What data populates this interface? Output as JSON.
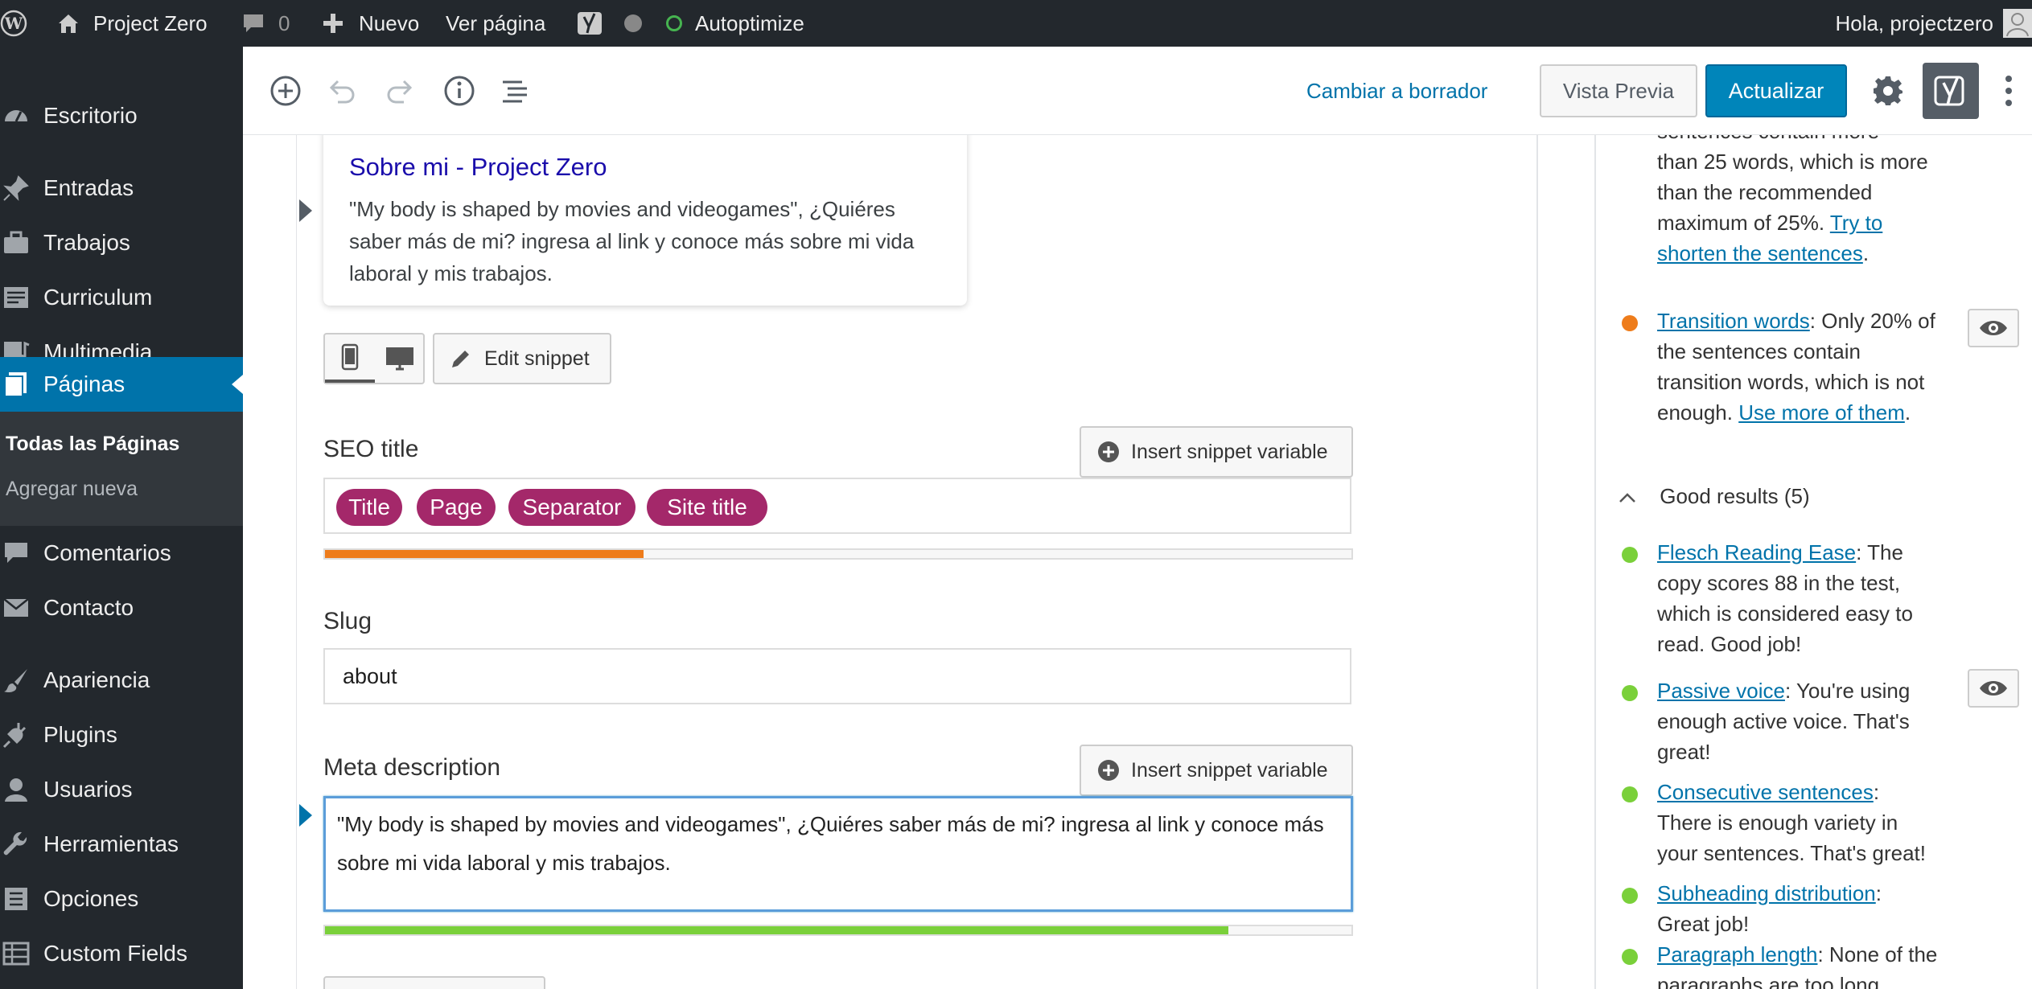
{
  "admin_bar": {
    "site_name": "Project Zero",
    "comments_count": "0",
    "new_label": "Nuevo",
    "view_page_label": "Ver página",
    "autoptimize_label": "Autoptimize",
    "greeting": "Hola, projectzero"
  },
  "sidebar": {
    "items": [
      {
        "label": "Escritorio",
        "icon": "dashboard-icon"
      },
      {
        "label": "Entradas",
        "icon": "pin-icon"
      },
      {
        "label": "Trabajos",
        "icon": "portfolio-icon"
      },
      {
        "label": "Curriculum",
        "icon": "document-icon"
      },
      {
        "label": "Multimedia",
        "icon": "media-icon"
      },
      {
        "label": "Páginas",
        "icon": "pages-icon"
      },
      {
        "label": "Comentarios",
        "icon": "comment-icon"
      },
      {
        "label": "Contacto",
        "icon": "mail-icon"
      },
      {
        "label": "Apariencia",
        "icon": "brush-icon"
      },
      {
        "label": "Plugins",
        "icon": "plugin-icon"
      },
      {
        "label": "Usuarios",
        "icon": "user-icon"
      },
      {
        "label": "Herramientas",
        "icon": "wrench-icon"
      },
      {
        "label": "Opciones",
        "icon": "settings-icon"
      },
      {
        "label": "Custom Fields",
        "icon": "table-icon"
      }
    ],
    "submenu": {
      "all_pages": "Todas las Páginas",
      "add_new": "Agregar nueva"
    }
  },
  "header": {
    "switch_to_draft": "Cambiar a borrador",
    "preview": "Vista Previa",
    "update": "Actualizar"
  },
  "snippet": {
    "title": "Sobre mi - Project Zero",
    "description": "\"My body is shaped by movies and videogames\", ¿Quiéres saber más de mi? ingresa al link y conoce más sobre mi vida laboral y mis trabajos.",
    "edit_snippet": "Edit snippet"
  },
  "seo": {
    "seo_title_label": "SEO title",
    "insert_variable": "Insert snippet variable",
    "title_pills": [
      "Title",
      "Page",
      "Separator",
      "Site title"
    ],
    "title_progress": 0.31,
    "title_progress_color": "#ee7c1b",
    "slug_label": "Slug",
    "slug_value": "about",
    "meta_label": "Meta description",
    "meta_value": "\"My body is shaped by movies and videogames\", ¿Quiéres saber más de mi? ingresa al link y conoce más sobre mi vida laboral y mis trabajos.",
    "meta_progress": 0.88,
    "meta_progress_color": "#7ad03a"
  },
  "analysis": {
    "partial_top": {
      "line1": "sentences contain more",
      "line2": "than 25 words, which is more than the recommended maximum of 25%. ",
      "link": "Try to shorten the sentences",
      "tail": "."
    },
    "transition": {
      "link": "Transition words",
      "text": ": Only 20% of the sentences contain transition words, which is not enough. ",
      "link2": "Use more of them",
      "tail": "."
    },
    "good_header": "Good results (5)",
    "good": [
      {
        "link": "Flesch Reading Ease",
        "text": ": The copy scores 88 in the test, which is considered easy to read. Good job!"
      },
      {
        "link": "Passive voice",
        "text": ": You're using enough active voice. That's great!"
      },
      {
        "link": "Consecutive sentences",
        "text": ": There is enough variety in your sentences. That's great!"
      },
      {
        "link": "Subheading distribution",
        "text": ": Great job!"
      },
      {
        "link": "Paragraph length",
        "text": ": None of the paragraphs are too long. Great"
      }
    ],
    "colors": {
      "bad": "#ee7c1b",
      "good": "#7ad03a"
    }
  }
}
